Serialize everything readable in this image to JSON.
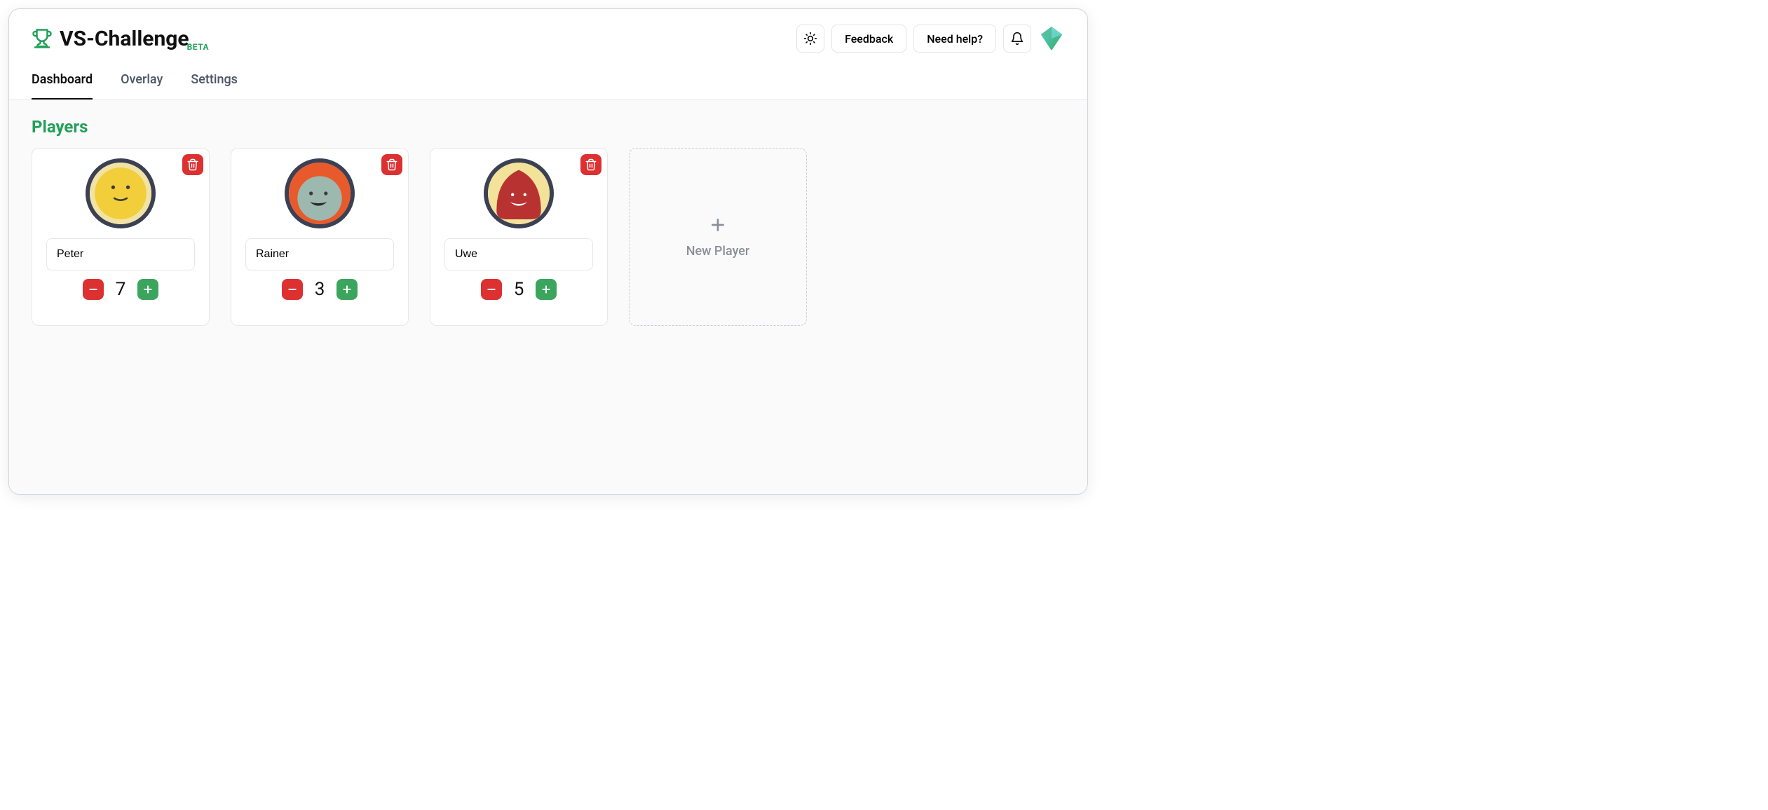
{
  "header": {
    "app_name": "VS-Challenge",
    "badge": "BETA",
    "feedback_label": "Feedback",
    "help_label": "Need help?"
  },
  "tabs": {
    "dashboard": "Dashboard",
    "overlay": "Overlay",
    "settings": "Settings"
  },
  "section": {
    "players_title": "Players",
    "new_player_label": "New Player"
  },
  "players": [
    {
      "name": "Peter",
      "score": "7"
    },
    {
      "name": "Rainer",
      "score": "3"
    },
    {
      "name": "Uwe",
      "score": "5"
    }
  ]
}
